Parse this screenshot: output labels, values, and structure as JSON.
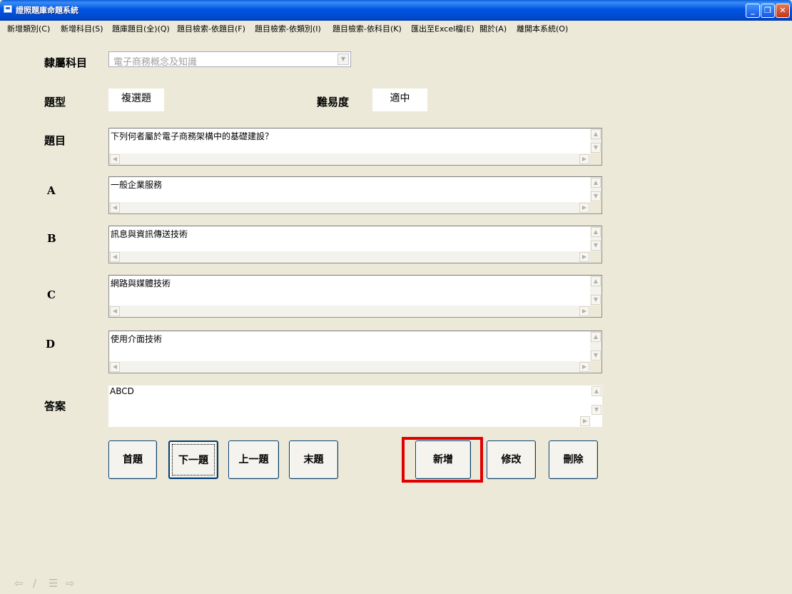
{
  "window": {
    "title": "證照題庫命題系統"
  },
  "menu": [
    "新增類別(C)",
    "新增科目(S)",
    "題庫題目(全)(Q)",
    "題目檢索-依題目(F)",
    "題目檢索-依類別(I)",
    "題目檢索-依科目(K)",
    "匯出至Excel檔(E)",
    "關於(A)",
    "離開本系統(O)"
  ],
  "labels": {
    "subject": "隸屬科目",
    "type": "題型",
    "difficulty": "難易度",
    "question": "題目",
    "a": "A",
    "b": "B",
    "c": "C",
    "d": "D",
    "answer": "答案"
  },
  "fields": {
    "subject": "電子商務概念及知識",
    "type": "複選題",
    "difficulty": "適中",
    "question": "下列何者屬於電子商務架構中的基礎建設？",
    "a": "一般企業服務",
    "b": "訊息與資訊傳送技術",
    "c": "網路與媒體技術",
    "d": "使用介面技術",
    "answer": "ABCD"
  },
  "buttons": {
    "first": "首題",
    "next": "下一題",
    "prev": "上一題",
    "last": "末題",
    "add": "新增",
    "edit": "修改",
    "delete": "刪除"
  },
  "icons": {
    "title": "app-form-icon",
    "bottom": [
      "back-arrow-icon",
      "pencil-icon",
      "list-icon",
      "forward-arrow-icon"
    ]
  },
  "colors": {
    "highlight": "#E00000",
    "titlebar": "#0054E3"
  }
}
